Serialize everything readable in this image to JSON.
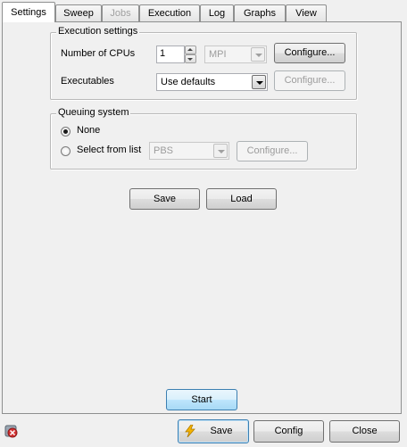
{
  "tabs": [
    {
      "label": "Settings",
      "active": true,
      "enabled": true
    },
    {
      "label": "Sweep",
      "active": false,
      "enabled": true
    },
    {
      "label": "Jobs",
      "active": false,
      "enabled": false
    },
    {
      "label": "Execution",
      "active": false,
      "enabled": true
    },
    {
      "label": "Log",
      "active": false,
      "enabled": true
    },
    {
      "label": "Graphs",
      "active": false,
      "enabled": true
    },
    {
      "label": "View",
      "active": false,
      "enabled": true
    }
  ],
  "execution_settings": {
    "title": "Execution settings",
    "cpus_label": "Number of CPUs",
    "cpus_value": "1",
    "mpi_value": "MPI",
    "configure_label": "Configure...",
    "executables_label": "Executables",
    "executables_value": "Use defaults",
    "configure2_label": "Configure..."
  },
  "queuing_system": {
    "title": "Queuing system",
    "none_label": "None",
    "select_label": "Select from list",
    "list_value": "PBS",
    "configure_label": "Configure...",
    "selected": "None"
  },
  "actions": {
    "save_label": "Save",
    "load_label": "Load",
    "start_label": "Start"
  },
  "footer": {
    "save_label": "Save",
    "config_label": "Config",
    "close_label": "Close"
  },
  "colors": {
    "panel": "#f0f0f0",
    "start_button": "#bee6fd",
    "disabled_text": "#9c9c9c"
  }
}
